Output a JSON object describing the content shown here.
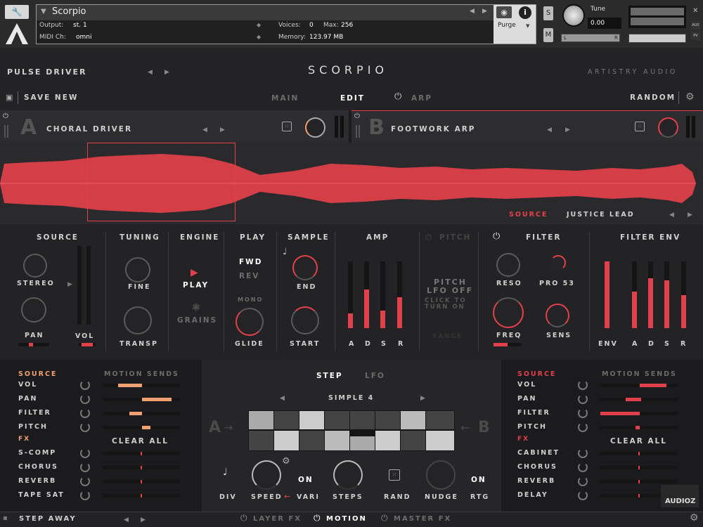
{
  "header": {
    "instrument": "Scorpio",
    "output_label": "Output:",
    "output_value": "st. 1",
    "voices_label": "Voices:",
    "voices_value": "0",
    "max_label": "Max:",
    "max_value": "256",
    "midi_label": "MIDI Ch:",
    "midi_value": "omni",
    "memory_label": "Memory:",
    "memory_value": "123.97 MB",
    "purge": "Purge",
    "tune_label": "Tune",
    "tune_value": "0.00",
    "s_btn": "S",
    "m_btn": "M",
    "l": "L",
    "r": "R",
    "aux": "AUX",
    "pv": "PV"
  },
  "top": {
    "preset": "PULSE DRIVER",
    "title": "SCORPIO",
    "brand": "ARTISTRY AUDIO"
  },
  "nav": {
    "save": "SAVE NEW",
    "main": "MAIN",
    "edit": "EDIT",
    "arp": "ARP",
    "random": "RANDOM"
  },
  "layerA": {
    "letter": "A",
    "name": "CHORAL DRIVER"
  },
  "layerB": {
    "letter": "B",
    "name": "FOOTWORK ARP"
  },
  "wave": {
    "source_label": "SOURCE",
    "source_name": "JUSTICE LEAD"
  },
  "edit": {
    "source": "SOURCE",
    "stereo": "STEREO",
    "pan": "PAN",
    "vol": "VOL",
    "tuning": "TUNING",
    "fine": "FINE",
    "transp": "TRANSP",
    "engine": "ENGINE",
    "play_btn": "PLAY",
    "grains": "GRAINS",
    "play": "PLAY",
    "fwd": "FWD",
    "rev": "REV",
    "mono": "MONO",
    "glide": "GLIDE",
    "sample": "SAMPLE",
    "end": "END",
    "start": "START",
    "amp": "AMP",
    "a": "A",
    "d": "D",
    "s": "S",
    "r": "R",
    "pitch": "PITCH",
    "pitch_lfo": "PITCH",
    "pitch_lfo2": "LFO OFF",
    "click": "CLICK TO",
    "turn": "TURN ON",
    "range": "RANGE",
    "filter": "FILTER",
    "reso": "RESO",
    "pro53": "PRO 53",
    "freq": "FREQ",
    "sens": "SENS",
    "filter_env": "FILTER ENV",
    "env": "ENV"
  },
  "amp_levels": [
    0.22,
    0.58,
    0.26,
    0.46
  ],
  "fenv_levels": [
    1.0,
    0.55,
    0.75,
    0.72,
    0.5
  ],
  "left_motion": {
    "source": "SOURCE",
    "sends": "MOTION SENDS",
    "items": [
      "VOL",
      "PAN",
      "FILTER",
      "PITCH"
    ],
    "fx": "FX",
    "clear": "CLEAR ALL",
    "fx_items": [
      "S-COMP",
      "CHORUS",
      "REVERB",
      "TAPE SAT"
    ]
  },
  "right_motion": {
    "source": "SOURCE",
    "sends": "MOTION SENDS",
    "items": [
      "VOL",
      "PAN",
      "FILTER",
      "PITCH"
    ],
    "fx": "FX",
    "clear": "CLEAR ALL",
    "fx_items": [
      "CABINET",
      "CHORUS",
      "REVERB",
      "DELAY"
    ]
  },
  "step": {
    "step_tab": "STEP",
    "lfo_tab": "LFO",
    "pattern": "SIMPLE 4",
    "a": "A",
    "b": "B",
    "div": "DIV",
    "speed": "SPEED",
    "vari": "VARI",
    "on1": "ON",
    "steps": "STEPS",
    "rand": "RAND",
    "nudge": "NUDGE",
    "on2": "ON",
    "rtg": "RTG"
  },
  "footer": {
    "preset": "STEP AWAY",
    "layer_fx": "LAYER FX",
    "motion": "MOTION",
    "master_fx": "MASTER FX"
  },
  "watermark": "AUDIOZ"
}
